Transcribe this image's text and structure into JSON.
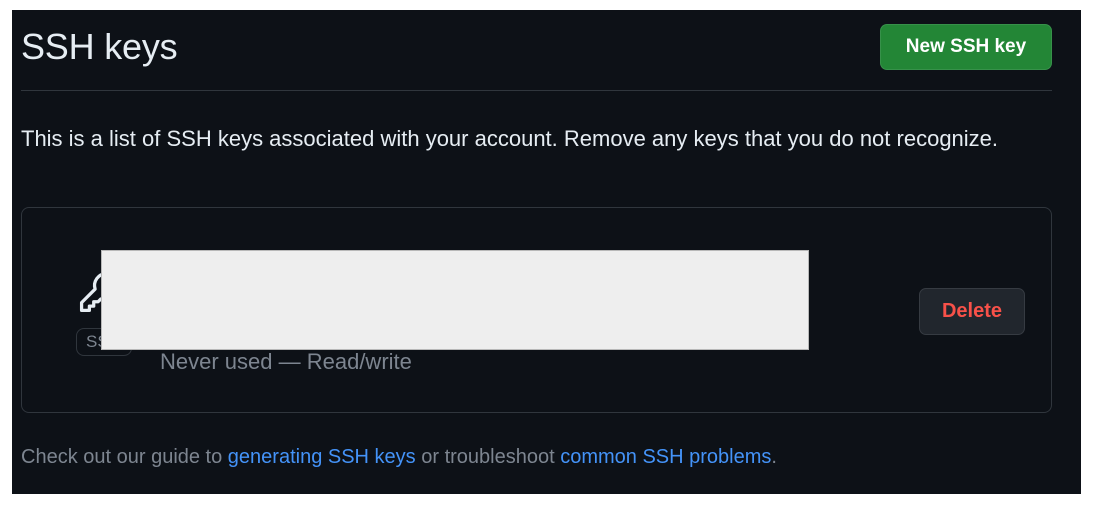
{
  "header": {
    "title": "SSH keys",
    "new_button_label": "New SSH key"
  },
  "intro_text": "This is a list of SSH keys associated with your account. Remove any keys that you do not recognize.",
  "keys": [
    {
      "icon": "key-icon",
      "type_badge": "SSH",
      "usage": "Never used — Read/write",
      "delete_label": "Delete"
    }
  ],
  "footer": {
    "prefix": "Check out our guide to ",
    "link1": "generating SSH keys",
    "middle": " or troubleshoot ",
    "link2": "common SSH problems",
    "suffix": "."
  },
  "colors": {
    "background": "#0d1117",
    "primary_button": "#238636",
    "danger_text": "#f85149",
    "link": "#4493f8",
    "muted_text": "#7d8590",
    "border": "#30363d"
  }
}
